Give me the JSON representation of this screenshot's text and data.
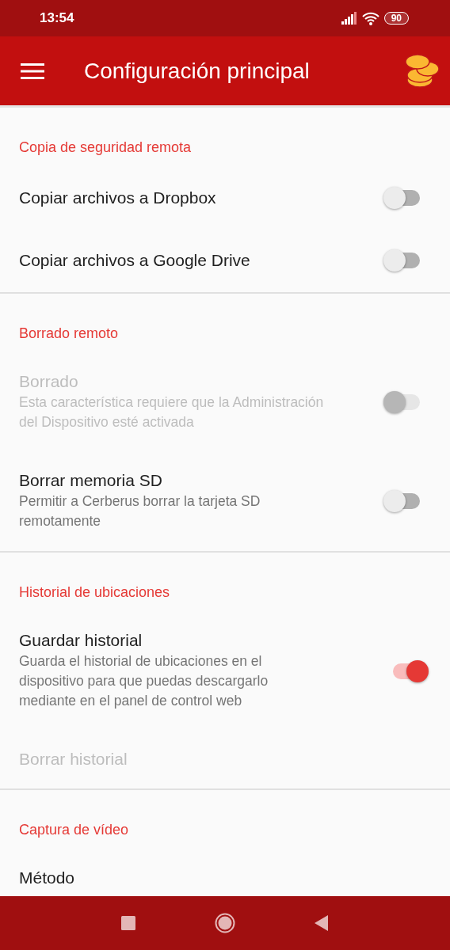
{
  "status_bar": {
    "time": "13:54",
    "battery": "90"
  },
  "app_bar": {
    "title": "Configuración principal"
  },
  "sections": [
    {
      "header": "Copia de seguridad remota",
      "items": [
        {
          "title": "Copiar archivos a Dropbox",
          "disabled": false,
          "switch": {
            "on": false
          }
        },
        {
          "title": "Copiar archivos a Google Drive",
          "disabled": false,
          "switch": {
            "on": false
          }
        }
      ]
    },
    {
      "header": "Borrado remoto",
      "items": [
        {
          "title": "Borrado",
          "summary": "Esta característica requiere que la Administración del Dispositivo esté activada",
          "disabled": true,
          "switch": {
            "on": false
          }
        },
        {
          "title": "Borrar memoria SD",
          "summary": "Permitir a Cerberus borrar la tarjeta SD remotamente",
          "disabled": false,
          "switch": {
            "on": false
          }
        }
      ]
    },
    {
      "header": "Historial de ubicaciones",
      "items": [
        {
          "title": "Guardar historial",
          "summary": "Guarda el historial de ubicaciones en el dispositivo para que puedas descargarlo mediante en el panel de control web",
          "disabled": false,
          "switch": {
            "on": true
          }
        },
        {
          "title": "Borrar historial",
          "disabled": true
        }
      ]
    },
    {
      "header": "Captura de vídeo",
      "items": [
        {
          "title": "Método",
          "disabled": false
        }
      ]
    }
  ]
}
